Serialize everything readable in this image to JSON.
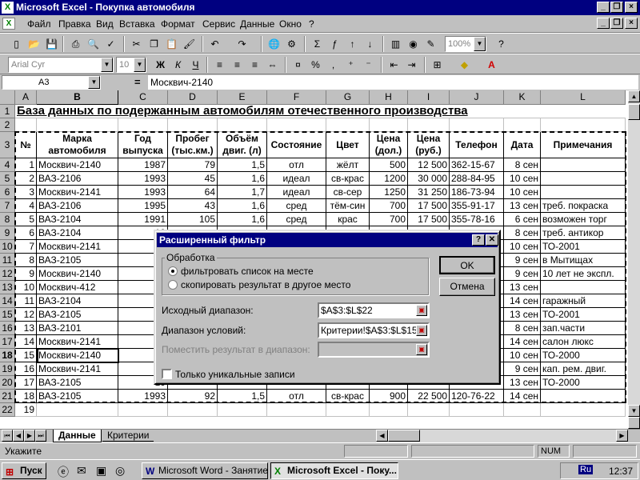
{
  "window": {
    "title": "Microsoft Excel - Покупка автомобиля",
    "app_icon": "excel-icon"
  },
  "menu": [
    "Файл",
    "Правка",
    "Вид",
    "Вставка",
    "Формат",
    "Сервис",
    "Данные",
    "Окно",
    "?"
  ],
  "toolbar": {
    "zoom": "100%",
    "font": "Arial Cyr",
    "font_size": "10",
    "bold": "Ж",
    "italic": "К",
    "underline": "Ч"
  },
  "formula_bar": {
    "cell_ref": "A3",
    "equals": "=",
    "content": "Москвич-2140"
  },
  "columns": [
    "A",
    "B",
    "C",
    "D",
    "E",
    "F",
    "G",
    "H",
    "I",
    "J",
    "K",
    "L"
  ],
  "sheet": {
    "title": "База данных по подержанным автомобилям отечественного производства",
    "headers": [
      "№",
      "Марка автомобиля",
      "Год выпуска",
      "Пробег (тыс.км.)",
      "Объём двиг. (л)",
      "Состояние",
      "Цвет",
      "Цена (дол.)",
      "Цена (руб.)",
      "Телефон",
      "Дата",
      "Примечания"
    ],
    "rows": [
      [
        "1",
        "Москвич-2140",
        "1987",
        "79",
        "1,5",
        "отл",
        "жёлт",
        "500",
        "12 500",
        "362-15-67",
        "8 сен",
        ""
      ],
      [
        "2",
        "ВАЗ-2106",
        "1993",
        "45",
        "1,6",
        "идеал",
        "св-крас",
        "1200",
        "30 000",
        "288-84-95",
        "10 сен",
        ""
      ],
      [
        "3",
        "Москвич-2141",
        "1993",
        "64",
        "1,7",
        "идеал",
        "св-сер",
        "1250",
        "31 250",
        "186-73-94",
        "10 сен",
        ""
      ],
      [
        "4",
        "ВАЗ-2106",
        "1995",
        "43",
        "1,6",
        "сред",
        "тём-син",
        "700",
        "17 500",
        "355-91-17",
        "13 сен",
        "треб. покраска"
      ],
      [
        "5",
        "ВАЗ-2104",
        "1991",
        "105",
        "1,6",
        "сред",
        "крас",
        "700",
        "17 500",
        "355-78-16",
        "6 сен",
        "возможен торг"
      ],
      [
        "6",
        "ВАЗ-2104",
        "19",
        "",
        "",
        "",
        "",
        "",
        "",
        "",
        "8 сен",
        "треб. антикор"
      ],
      [
        "7",
        "Москвич-2141",
        "19",
        "",
        "",
        "",
        "",
        "",
        "",
        "",
        "10 сен",
        "ТО-2001"
      ],
      [
        "8",
        "ВАЗ-2105",
        "19",
        "",
        "",
        "",
        "",
        "",
        "",
        "",
        "9 сен",
        "в Мытищах"
      ],
      [
        "9",
        "Москвич-2140",
        "19",
        "",
        "",
        "",
        "",
        "",
        "",
        "",
        "9 сен",
        "10 лет не экспл."
      ],
      [
        "10",
        "Москвич-412",
        "19",
        "",
        "",
        "",
        "",
        "",
        "",
        "",
        "13 сен",
        ""
      ],
      [
        "11",
        "ВАЗ-2104",
        "19",
        "",
        "",
        "",
        "",
        "",
        "",
        "",
        "14 сен",
        "гаражный"
      ],
      [
        "12",
        "ВАЗ-2105",
        "19",
        "",
        "",
        "",
        "",
        "",
        "",
        "",
        "13 сен",
        "ТО-2001"
      ],
      [
        "13",
        "ВАЗ-2101",
        "19",
        "",
        "",
        "",
        "",
        "",
        "",
        "",
        "8 сен",
        "зап.части"
      ],
      [
        "14",
        "Москвич-2141",
        "19",
        "",
        "",
        "",
        "",
        "",
        "",
        "",
        "14 сен",
        "салон люкс"
      ],
      [
        "15",
        "Москвич-2140",
        "19",
        "",
        "",
        "",
        "",
        "",
        "",
        "",
        "10 сен",
        "ТО-2000"
      ],
      [
        "16",
        "Москвич-2141",
        "19",
        "",
        "",
        "",
        "",
        "",
        "",
        "",
        "9 сен",
        "кап. рем. двиг."
      ],
      [
        "17",
        "ВАЗ-2105",
        "19",
        "",
        "",
        "",
        "",
        "",
        "",
        "",
        "13 сен",
        "ТО-2000"
      ],
      [
        "18",
        "ВАЗ-2105",
        "1993",
        "92",
        "1,5",
        "отл",
        "св-крас",
        "900",
        "22 500",
        "120-76-22",
        "14 сен",
        ""
      ],
      [
        "19",
        "",
        "",
        "",
        "",
        "",
        "",
        "",
        "",
        "",
        "",
        ""
      ]
    ]
  },
  "sheet_tabs": [
    "Данные",
    "Критерии"
  ],
  "status": {
    "text": "Укажите",
    "num": "NUM"
  },
  "dialog": {
    "title": "Расширенный фильтр",
    "group_label": "Обработка",
    "radio_filter": "фильтровать список на месте",
    "radio_copy": "скопировать результат в другое место",
    "source_label": "Исходный диапазон:",
    "source_value": "$A$3:$L$22",
    "criteria_label": "Диапазон условий:",
    "criteria_value": "Критерии!$A$3:$L$15",
    "dest_label": "Поместить результат в диапазон:",
    "dest_value": "",
    "unique_label": "Только уникальные записи",
    "ok": "OK",
    "cancel": "Отмена",
    "help": "?",
    "close": "✕"
  },
  "taskbar": {
    "start": "Пуск",
    "word": "Microsoft Word - Занятие 8",
    "excel": "Microsoft Excel - Поку...",
    "lang": "Ru",
    "time": "12:37"
  }
}
